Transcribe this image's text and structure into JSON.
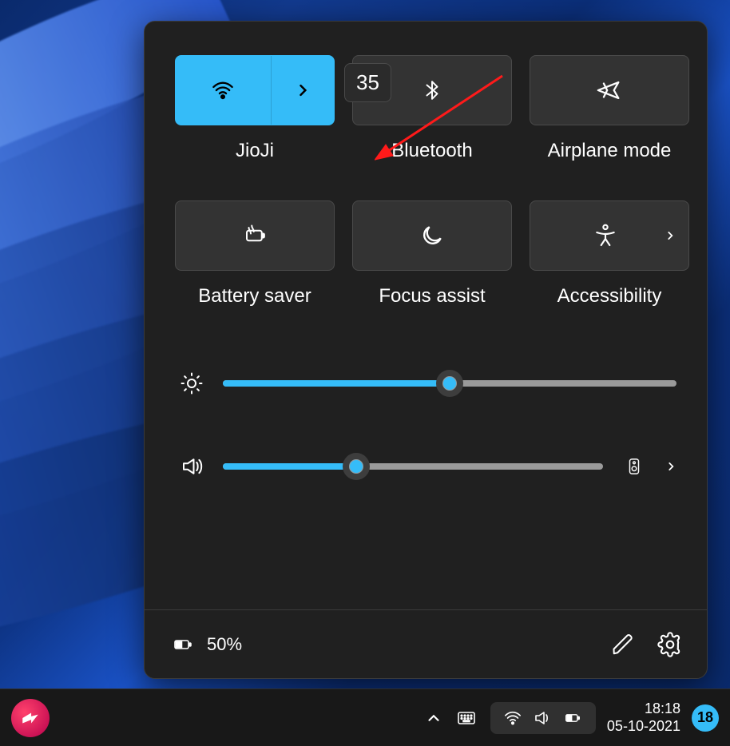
{
  "quickSettings": {
    "tiles": [
      {
        "label": "JioJi",
        "active": true,
        "hasExpand": true
      },
      {
        "label": "Bluetooth",
        "active": false,
        "hasExpand": false
      },
      {
        "label": "Airplane mode",
        "active": false,
        "hasExpand": false
      },
      {
        "label": "Battery saver",
        "active": false,
        "hasExpand": false
      },
      {
        "label": "Focus assist",
        "active": false,
        "hasExpand": false
      },
      {
        "label": "Accessibility",
        "active": false,
        "hasExpand": true
      }
    ],
    "brightness": {
      "percent": 50
    },
    "volume": {
      "percent": 35,
      "tooltip": "35"
    },
    "footer": {
      "battery_text": "50%"
    }
  },
  "taskbar": {
    "clock_time": "18:18",
    "clock_date": "05-10-2021",
    "notification_count": "18"
  },
  "colors": {
    "accent": "#35bcf8",
    "panel": "#202020",
    "tile": "#333333"
  }
}
